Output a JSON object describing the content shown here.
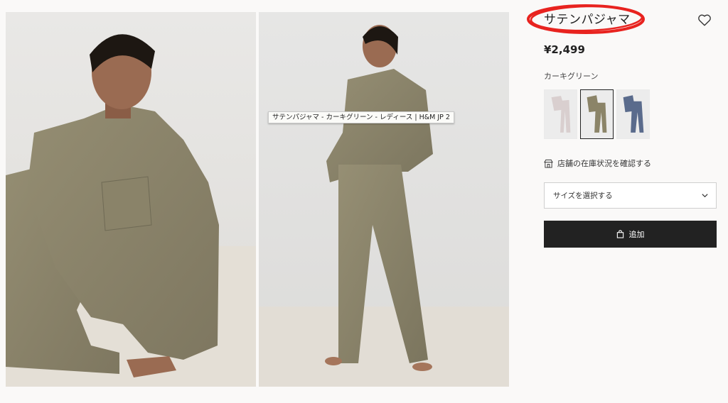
{
  "product": {
    "title": "サテンパジャマ",
    "price": "¥2,499",
    "color_name": "カーキグリーン",
    "swatches": [
      {
        "name": "light-pink",
        "color": "#d9cfcf"
      },
      {
        "name": "khaki-green",
        "color": "#8b8468",
        "selected": true
      },
      {
        "name": "blue",
        "color": "#5a6b8c"
      }
    ],
    "store_check": "店舗の在庫状況を確認する",
    "size_placeholder": "サイズを選択する",
    "add_button": "追加"
  },
  "tooltip": "サテンパジャマ - カーキグリーン - レディース | H&M JP 2",
  "icons": {
    "favorite": "heart-icon",
    "store": "store-icon",
    "dropdown": "chevron-down-icon",
    "bag": "shopping-bag-icon"
  },
  "colors": {
    "annotation_circle": "#e8231f",
    "khaki": "#8b8468",
    "button_bg": "#222222"
  }
}
